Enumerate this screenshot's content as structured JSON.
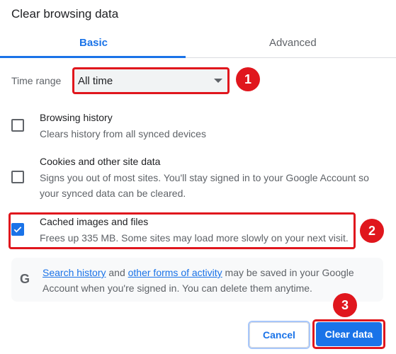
{
  "dialog": {
    "title": "Clear browsing data"
  },
  "tabs": [
    {
      "label": "Basic",
      "active": true
    },
    {
      "label": "Advanced",
      "active": false
    }
  ],
  "time_range": {
    "label": "Time range",
    "selected": "All time"
  },
  "options": [
    {
      "title": "Browsing history",
      "desc": [
        "Clears history from all synced devices"
      ],
      "checked": false
    },
    {
      "title": "Cookies and other site data",
      "desc": [
        "Signs you out of most sites. You'll stay signed in to your Google Account so",
        "your synced data can be cleared."
      ],
      "checked": false
    },
    {
      "title": "Cached images and files",
      "desc": [
        "Frees up 335 MB. Some sites may load more slowly on your next visit."
      ],
      "checked": true
    }
  ],
  "info": {
    "icon": "google-g-icon",
    "link1": "Search history",
    "text1": " and ",
    "link2": "other forms of activity",
    "text2": " may be saved in your Google",
    "line2": "Account when you're signed in. You can delete them anytime."
  },
  "buttons": {
    "cancel": "Cancel",
    "clear": "Clear data"
  },
  "annotations": [
    "1",
    "2",
    "3"
  ],
  "colors": {
    "accent": "#1a73e8",
    "annotation": "#e0161d"
  }
}
